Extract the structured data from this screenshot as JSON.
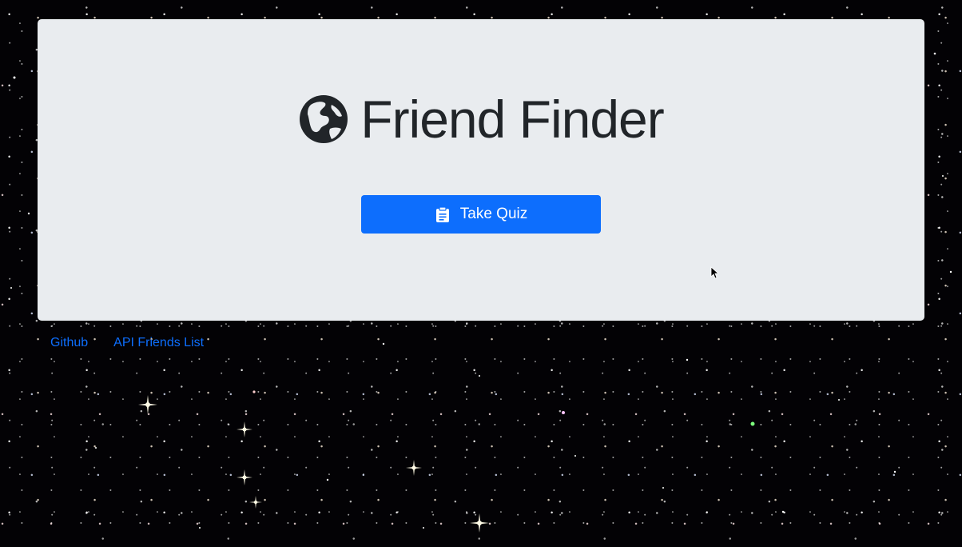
{
  "header": {
    "title": "Friend Finder",
    "icon": "globe-icon"
  },
  "main": {
    "quiz_button_label": "Take Quiz",
    "quiz_button_icon": "clipboard-icon"
  },
  "footer_links": [
    {
      "label": "Github"
    },
    {
      "label": "API Friends List"
    }
  ],
  "colors": {
    "accent": "#0d6efd",
    "panel": "#e9ecef",
    "title_text": "#212529",
    "background": "#030205"
  }
}
